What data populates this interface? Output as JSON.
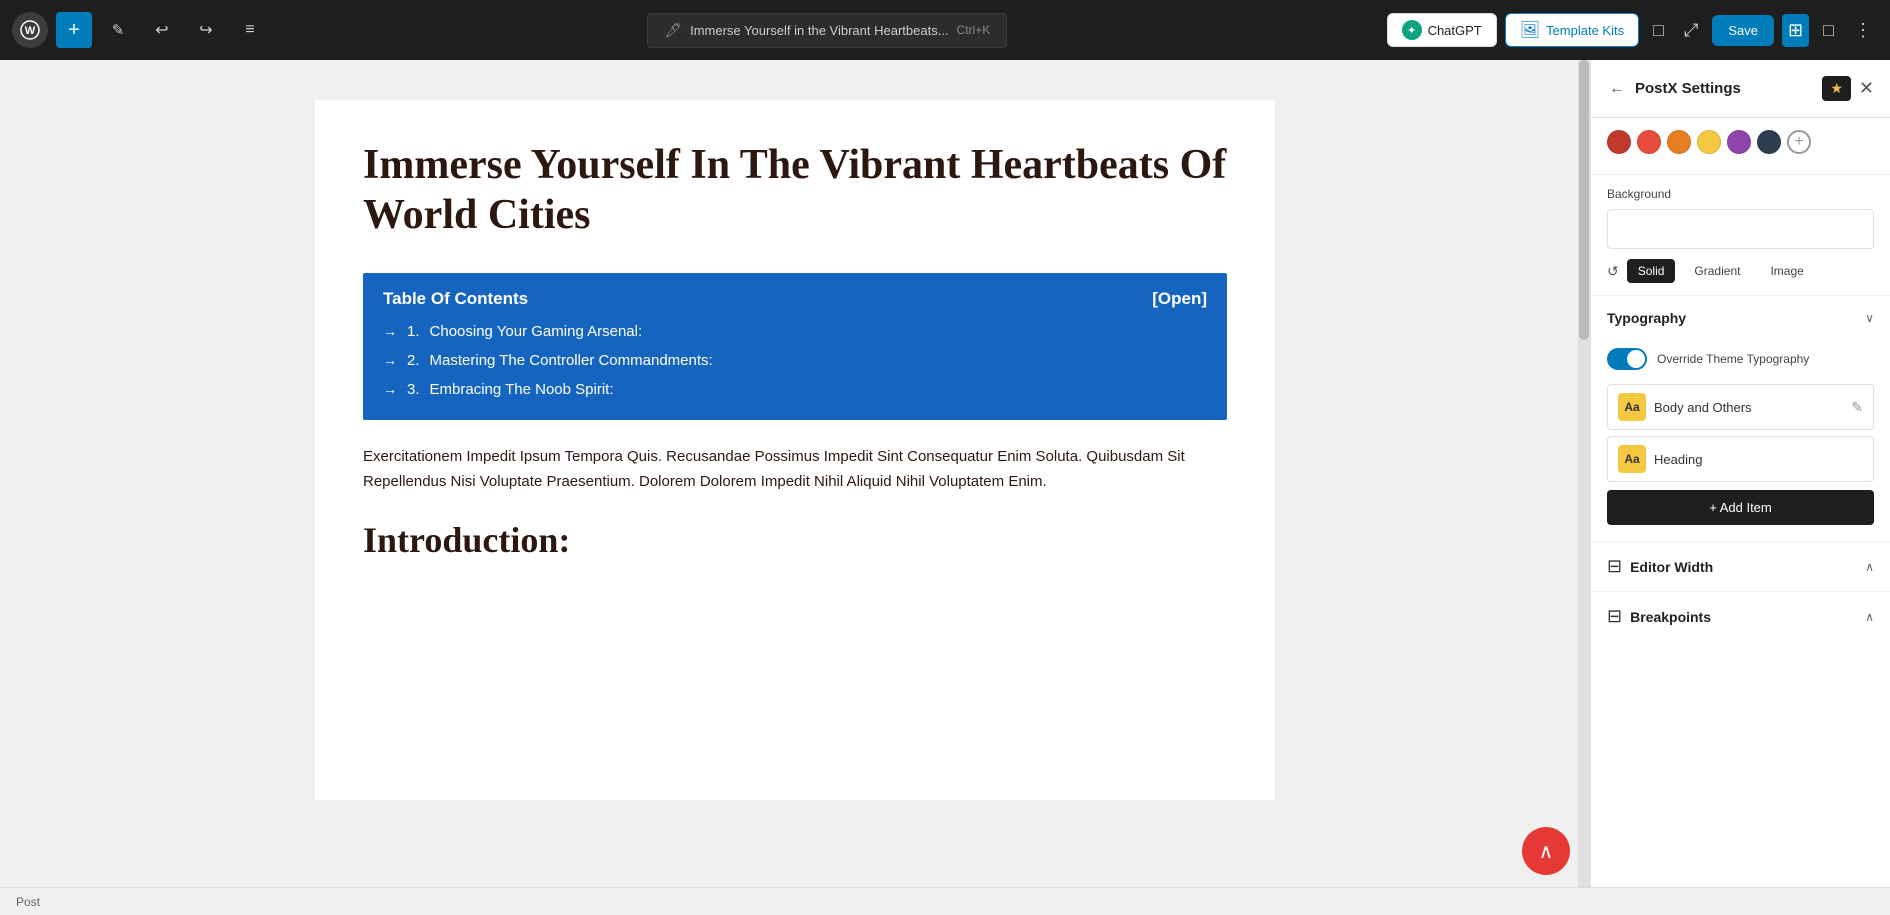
{
  "toolbar": {
    "wp_logo": "W",
    "add_label": "+",
    "edit_label": "✎",
    "undo_label": "↩",
    "redo_label": "↪",
    "menu_label": "≡",
    "post_title": "Immerse Yourself in the Vibrant Heartbeats...",
    "shortcut": "Ctrl+K",
    "chatgpt_label": "ChatGPT",
    "template_kits_label": "Template Kits",
    "save_label": "Save",
    "desktop_icon": "□",
    "external_icon": "⤢",
    "panel_icon": "⊞",
    "dots_icon": "⋮"
  },
  "editor": {
    "heading": "Immerse Yourself In The Vibrant Heartbeats Of World Cities",
    "toc_title": "Table Of Contents",
    "toc_open": "[Open]",
    "toc_items": [
      {
        "number": "1.",
        "text": "Choosing Your Gaming Arsenal:"
      },
      {
        "number": "2.",
        "text": "Mastering The Controller Commandments:"
      },
      {
        "number": "3.",
        "text": "Embracing The Noob Spirit:"
      }
    ],
    "body_text": "Exercitationem Impedit Ipsum Tempora Quis. Recusandae Possimus Impedit Sint Consequatur Enim Soluta. Quibusdam Sit Repellendus Nisi Voluptate Praesentium. Dolorem Dolorem Impedit Nihil Aliquid Nihil Voluptatem Enim.",
    "intro_heading": "Introduction:",
    "status_bar": "Post"
  },
  "sidebar": {
    "title": "PostX Settings",
    "back_icon": "←",
    "star_icon": "★",
    "close_icon": "✕",
    "color_swatches": [
      {
        "color": "#c0392b"
      },
      {
        "color": "#e74c3c"
      },
      {
        "color": "#e67e22"
      },
      {
        "color": "#f39c12"
      },
      {
        "color": "#8e44ad"
      },
      {
        "color": "#2c3e50"
      }
    ],
    "add_swatch_icon": "+",
    "background_label": "Background",
    "bg_type_reset_icon": "↺",
    "bg_types": [
      "Solid",
      "Gradient",
      "Image"
    ],
    "bg_active_type": "Solid",
    "typography_label": "Typography",
    "typography_chevron": "∨",
    "override_typography_label": "Override Theme Typography",
    "type_items": [
      {
        "icon": "Aa",
        "name": "Body and Others"
      },
      {
        "icon": "Aa",
        "name": "Heading"
      }
    ],
    "edit_icon": "✎",
    "add_item_label": "+ Add Item",
    "editor_width_label": "Editor Width",
    "editor_width_chevron": "∧",
    "editor_width_icon": "⊟",
    "breakpoints_label": "Breakpoints",
    "breakpoints_chevron": "∧",
    "breakpoints_icon": "⊟"
  },
  "scroll_top_icon": "∧"
}
